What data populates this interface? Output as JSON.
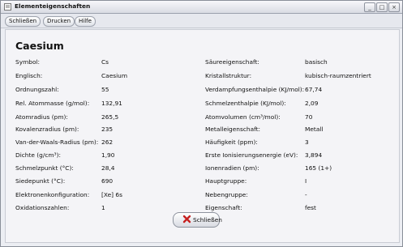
{
  "window": {
    "title": "Elementeigenschaften"
  },
  "window_buttons": [
    "_",
    "□",
    "×"
  ],
  "toolbar": {
    "close": "Schließen",
    "print": "Drucken",
    "help": "Hilfe"
  },
  "heading": "Caesium",
  "left_rows": [
    {
      "label": "Symbol:",
      "value": "Cs"
    },
    {
      "label": "Englisch:",
      "value": "Caesium"
    },
    {
      "label": "Ordnungszahl:",
      "value": "55"
    },
    {
      "label": "Rel. Atommasse (g/mol):",
      "value": "132,91"
    },
    {
      "label": "Atomradius (pm):",
      "value": "265,5"
    },
    {
      "label": "Kovalenzradius (pm):",
      "value": "235"
    },
    {
      "label": "Van-der-Waals-Radius (pm):",
      "value": "262"
    },
    {
      "label": "Dichte (g/cm³):",
      "value": "1,90"
    },
    {
      "label": "Schmelzpunkt (°C):",
      "value": "28,4"
    },
    {
      "label": "Siedepunkt (°C):",
      "value": "690"
    },
    {
      "label": "Elektronenkonfiguration:",
      "value": "[Xe] 6s"
    },
    {
      "label": "Oxidationszahlen:",
      "value": "1"
    }
  ],
  "right_rows": [
    {
      "label": "Säureeigenschaft:",
      "value": "basisch"
    },
    {
      "label": "Kristallstruktur:",
      "value": "kubisch-raumzentriert"
    },
    {
      "label": "Verdampfungsenthalpie (KJ/mol):",
      "value": "67,74"
    },
    {
      "label": "Schmelzenthalpie (KJ/mol):",
      "value": "2,09"
    },
    {
      "label": "Atomvolumen (cm³/mol):",
      "value": "70"
    },
    {
      "label": "Metalleigenschaft:",
      "value": "Metall"
    },
    {
      "label": "Häufigkeit (ppm):",
      "value": "3"
    },
    {
      "label": "Erste Ionisierungsenergie (eV):",
      "value": "3,894"
    },
    {
      "label": "Ionenradien (pm):",
      "value": "165 (1+)"
    },
    {
      "label": "Hauptgruppe:",
      "value": "I"
    },
    {
      "label": "Nebengruppe:",
      "value": "-"
    },
    {
      "label": "Eigenschaft:",
      "value": "fest"
    }
  ],
  "close_button": "Schließen",
  "colors": {
    "close_icon_red": "#c62020"
  }
}
